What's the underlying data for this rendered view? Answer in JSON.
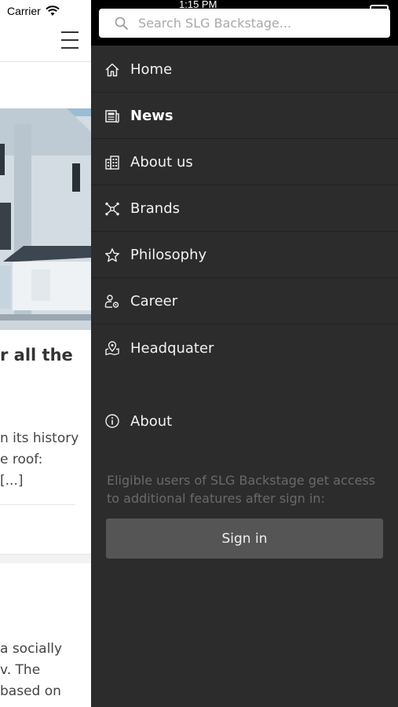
{
  "status": {
    "carrier": "Carrier",
    "time": "1:15 PM"
  },
  "background_page": {
    "article_title": "r all the",
    "article_body": [
      "n its history",
      "e roof:",
      "[...]"
    ],
    "article2_body": [
      "a socially",
      "v. The",
      "based on"
    ]
  },
  "search": {
    "placeholder": "Search SLG Backstage..."
  },
  "nav": {
    "items": [
      {
        "label": "Home",
        "icon": "home-icon"
      },
      {
        "label": "News",
        "icon": "news-icon"
      },
      {
        "label": "About us",
        "icon": "building-icon"
      },
      {
        "label": "Brands",
        "icon": "network-icon"
      },
      {
        "label": "Philosophy",
        "icon": "star-icon"
      },
      {
        "label": "Career",
        "icon": "career-icon"
      },
      {
        "label": "Headquater",
        "icon": "map-pin-icon"
      }
    ],
    "active_index": 1
  },
  "about": {
    "label": "About",
    "icon": "info-icon"
  },
  "signin": {
    "hint": "Eligible users of SLG Backstage get access to additional features after sign in:",
    "button_label": "Sign in"
  }
}
